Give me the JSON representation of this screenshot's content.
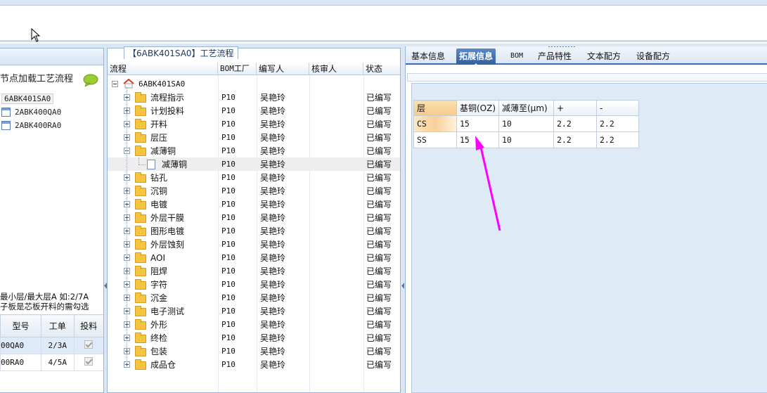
{
  "left": {
    "title": "节点加载工艺流程",
    "items": [
      {
        "label": "6ABK401SA0",
        "selected": true
      },
      {
        "label": "2ABK400QA0",
        "selected": false
      },
      {
        "label": "2ABK400RA0",
        "selected": false
      }
    ],
    "note_line1": "最小层/最大层A 如:2/7A",
    "note_line2": "子板是芯板开料的需勾选",
    "table": {
      "headers": [
        "型号",
        "工单",
        "投料"
      ],
      "rows": [
        {
          "model": "00QA0",
          "order": "2/3A",
          "checked": true
        },
        {
          "model": "00RA0",
          "order": "4/5A",
          "checked": true
        }
      ]
    }
  },
  "middle": {
    "caption": "【6ABK401SA0】工艺流程",
    "headers": [
      "流程",
      "BOM工厂",
      "编写人",
      "核审人",
      "状态"
    ],
    "root": "6ABK401SA0",
    "nodes": [
      {
        "name": "流程指示",
        "bom": "P10",
        "editor": "吴艳玲",
        "status": "已编写",
        "level": 1,
        "expand": "plus"
      },
      {
        "name": "计划投料",
        "bom": "P10",
        "editor": "吴艳玲",
        "status": "已编写",
        "level": 1,
        "expand": "plus"
      },
      {
        "name": "开料",
        "bom": "P10",
        "editor": "吴艳玲",
        "status": "已编写",
        "level": 1,
        "expand": "plus"
      },
      {
        "name": "层压",
        "bom": "P10",
        "editor": "吴艳玲",
        "status": "已编写",
        "level": 1,
        "expand": "plus"
      },
      {
        "name": "减薄铜",
        "bom": "P10",
        "editor": "吴艳玲",
        "status": "已编写",
        "level": 1,
        "expand": "minus"
      },
      {
        "name": "减薄铜",
        "bom": "P10",
        "editor": "吴艳玲",
        "status": "已编写",
        "level": 2,
        "expand": "none",
        "selected": true
      },
      {
        "name": "钻孔",
        "bom": "P10",
        "editor": "吴艳玲",
        "status": "已编写",
        "level": 1,
        "expand": "plus"
      },
      {
        "name": "沉铜",
        "bom": "P10",
        "editor": "吴艳玲",
        "status": "已编写",
        "level": 1,
        "expand": "plus"
      },
      {
        "name": "电镀",
        "bom": "P10",
        "editor": "吴艳玲",
        "status": "已编写",
        "level": 1,
        "expand": "plus"
      },
      {
        "name": "外层干膜",
        "bom": "P10",
        "editor": "吴艳玲",
        "status": "已编写",
        "level": 1,
        "expand": "plus"
      },
      {
        "name": "图形电镀",
        "bom": "P10",
        "editor": "吴艳玲",
        "status": "已编写",
        "level": 1,
        "expand": "plus"
      },
      {
        "name": "外层蚀刻",
        "bom": "P10",
        "editor": "吴艳玲",
        "status": "已编写",
        "level": 1,
        "expand": "plus"
      },
      {
        "name": "AOI",
        "bom": "P10",
        "editor": "吴艳玲",
        "status": "已编写",
        "level": 1,
        "expand": "plus"
      },
      {
        "name": "阻焊",
        "bom": "P10",
        "editor": "吴艳玲",
        "status": "已编写",
        "level": 1,
        "expand": "plus"
      },
      {
        "name": "字符",
        "bom": "P10",
        "editor": "吴艳玲",
        "status": "已编写",
        "level": 1,
        "expand": "plus"
      },
      {
        "name": "沉金",
        "bom": "P10",
        "editor": "吴艳玲",
        "status": "已编写",
        "level": 1,
        "expand": "plus"
      },
      {
        "name": "电子测试",
        "bom": "P10",
        "editor": "吴艳玲",
        "status": "已编写",
        "level": 1,
        "expand": "plus"
      },
      {
        "name": "外形",
        "bom": "P10",
        "editor": "吴艳玲",
        "status": "已编写",
        "level": 1,
        "expand": "plus"
      },
      {
        "name": "终检",
        "bom": "P10",
        "editor": "吴艳玲",
        "status": "已编写",
        "level": 1,
        "expand": "plus"
      },
      {
        "name": "包装",
        "bom": "P10",
        "editor": "吴艳玲",
        "status": "已编写",
        "level": 1,
        "expand": "plus"
      },
      {
        "name": "成品仓",
        "bom": "P10",
        "editor": "吴艳玲",
        "status": "已编写",
        "level": 1,
        "expand": "plus"
      }
    ]
  },
  "right": {
    "tabs": [
      {
        "label": "基本信息",
        "active": false
      },
      {
        "label": "拓展信息",
        "active": true
      },
      {
        "label": "BOM",
        "active": false
      },
      {
        "label": "产品特性",
        "active": false
      },
      {
        "label": "文本配方",
        "active": false
      },
      {
        "label": "设备配方",
        "active": false
      }
    ],
    "table": {
      "headers": [
        "层",
        "基铜(OZ)",
        "减薄至(μm)",
        "+",
        "-"
      ],
      "rows": [
        [
          "CS",
          "15",
          "10",
          "2.2",
          "2.2"
        ],
        [
          "SS",
          "15",
          "10",
          "2.2",
          "2.2"
        ]
      ]
    }
  },
  "colors": {
    "accent": "#3b6fb4",
    "annotation_arrow": "#ff00ff",
    "selection": "#f9cf97"
  }
}
